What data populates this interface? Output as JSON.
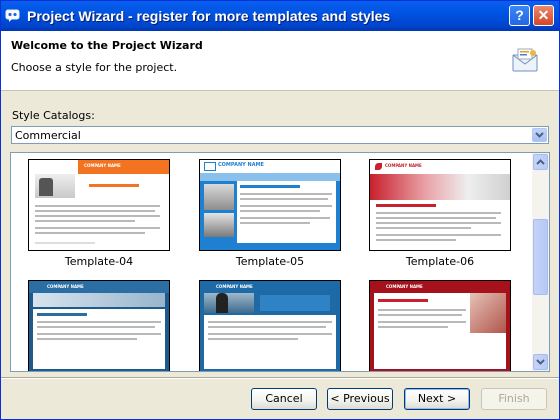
{
  "window": {
    "title": "Project Wizard - register for more templates and styles",
    "help_label": "?",
    "close_label": "✕"
  },
  "header": {
    "title": "Welcome to the Project Wizard",
    "subtitle": "Choose a style for the project."
  },
  "catalog": {
    "label": "Style Catalogs:",
    "selected": "Commercial"
  },
  "templates": [
    {
      "label": "Template-04",
      "logo": "COMPANY NAME",
      "accent": "#f37321"
    },
    {
      "label": "Template-05",
      "logo": "COMPANY NAME",
      "accent": "#1f7fd1"
    },
    {
      "label": "Template-06",
      "logo": "COMPANY NAME",
      "accent": "#c8202d"
    },
    {
      "label": "",
      "logo": "COMPANY NAME",
      "accent": "#1e5a8c"
    },
    {
      "label": "",
      "logo": "COMPANY NAME",
      "accent": "#1d6aa6"
    },
    {
      "label": "",
      "logo": "COMPANY NAME",
      "accent": "#a5121b"
    }
  ],
  "buttons": {
    "cancel": "Cancel",
    "previous": "< Previous",
    "next": "Next >",
    "finish": "Finish"
  }
}
